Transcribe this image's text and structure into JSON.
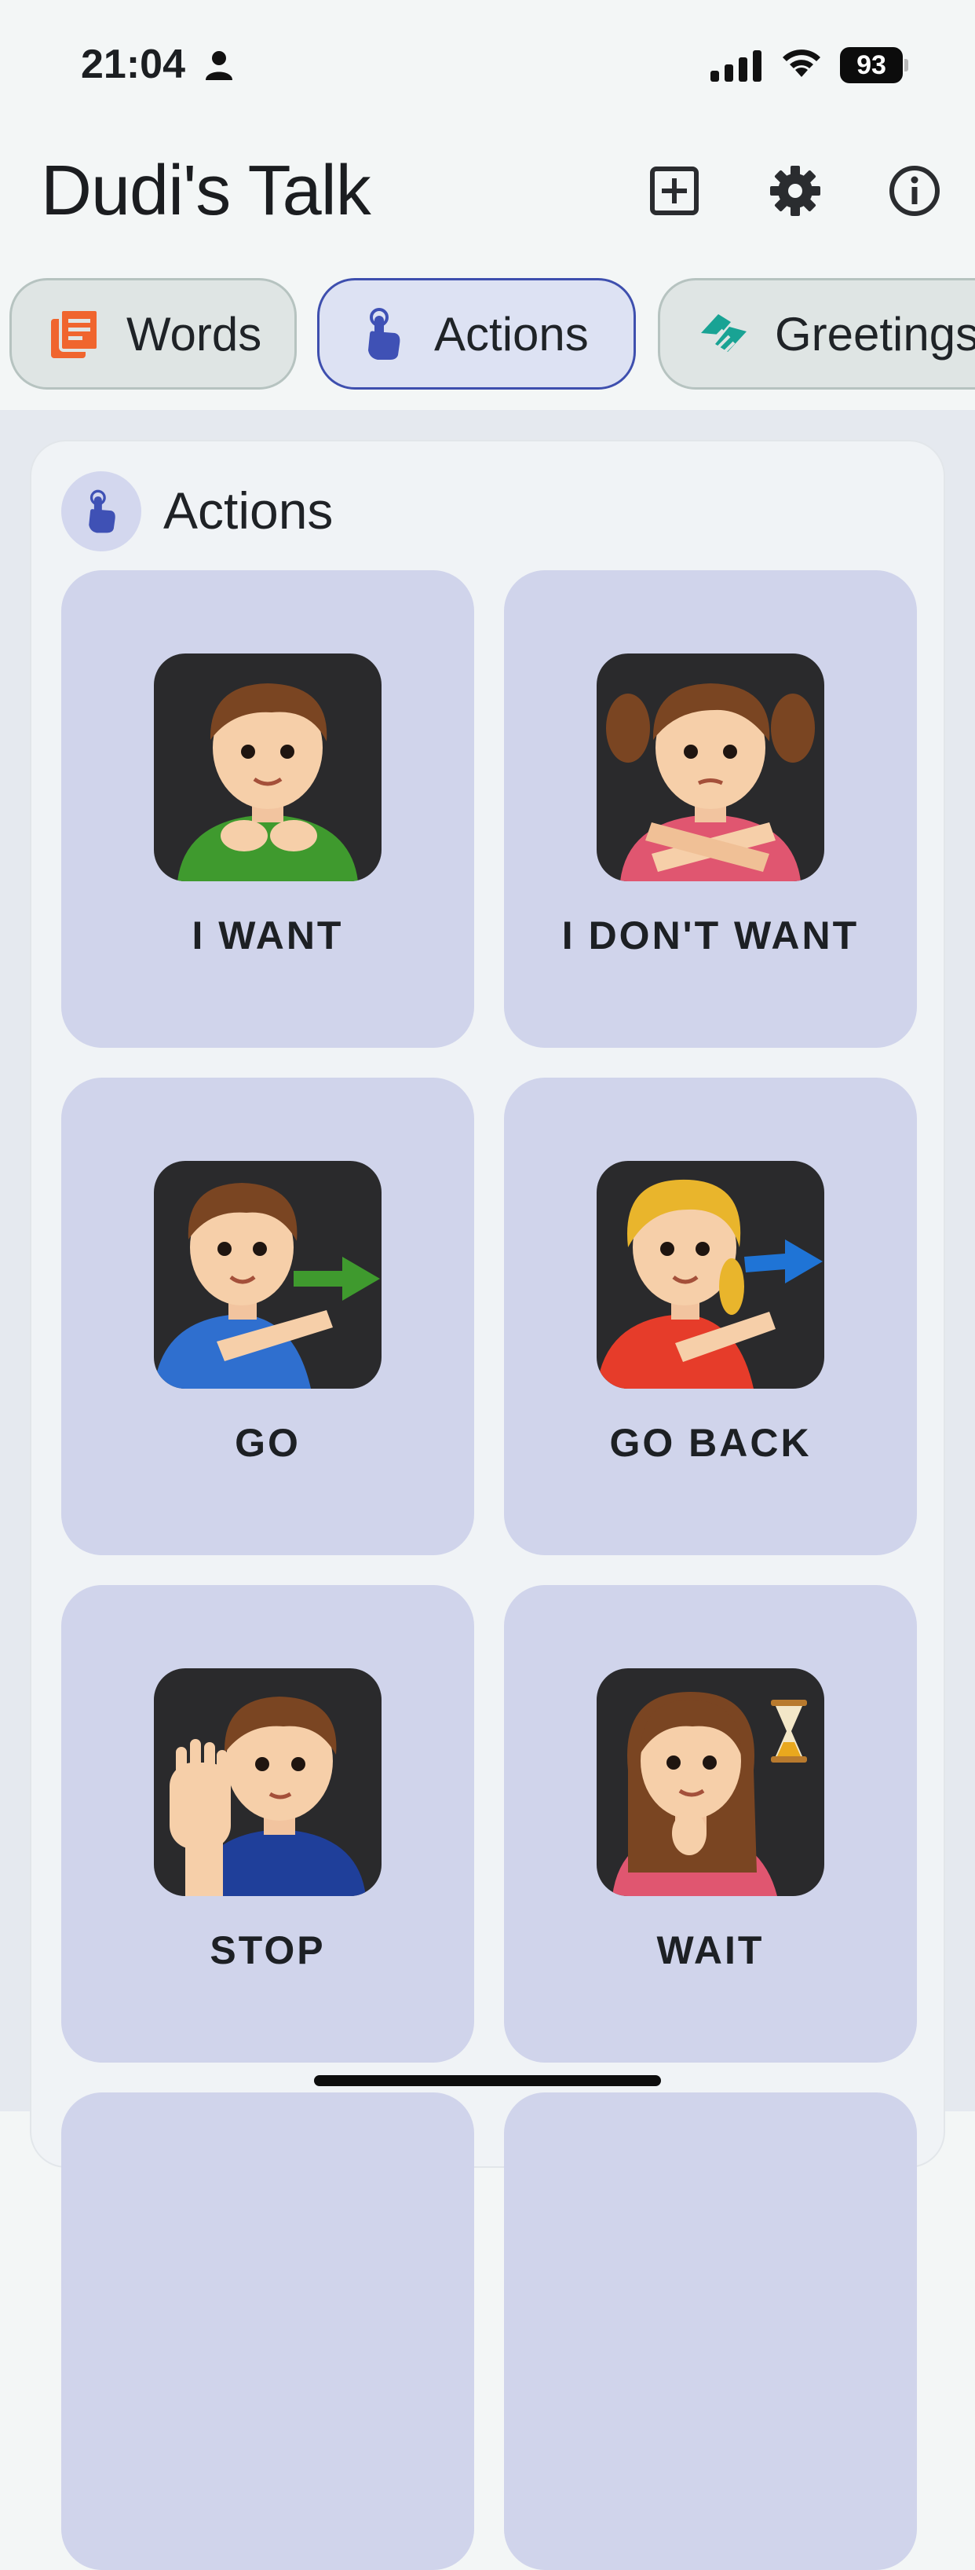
{
  "status_bar": {
    "time": "21:04",
    "battery": "93",
    "icons": [
      "person-icon",
      "cellular-signal-icon",
      "wifi-icon",
      "battery-icon"
    ]
  },
  "header": {
    "title": "Dudi's Talk",
    "actions": [
      "add-box-icon",
      "gear-icon",
      "info-icon"
    ]
  },
  "tabs": [
    {
      "label": "Words",
      "icon": "book-stack-icon",
      "active": false,
      "color": "#f0652e"
    },
    {
      "label": "Actions",
      "icon": "pointing-hand-icon",
      "active": true,
      "color": "#3f51b5"
    },
    {
      "label": "Greetings",
      "icon": "handshake-icon",
      "active": false,
      "color": "#19a394"
    }
  ],
  "section": {
    "title": "Actions",
    "icon": "pointing-hand-icon",
    "tiles": [
      {
        "label": "I WANT",
        "picture": "boy-green-shirt-hands-on-chest"
      },
      {
        "label": "I DON'T WANT",
        "picture": "girl-arms-crossed"
      },
      {
        "label": "GO",
        "picture": "boy-pointing-green-arrow"
      },
      {
        "label": "GO BACK",
        "picture": "girl-pointing-blue-arrow"
      },
      {
        "label": "STOP",
        "picture": "boy-raised-palm"
      },
      {
        "label": "WAIT",
        "picture": "girl-with-hourglass"
      }
    ]
  },
  "colors": {
    "accent": "#3f51b5",
    "tile_background": "#d0d4eb",
    "active_tab_border": "#3e4fae"
  }
}
